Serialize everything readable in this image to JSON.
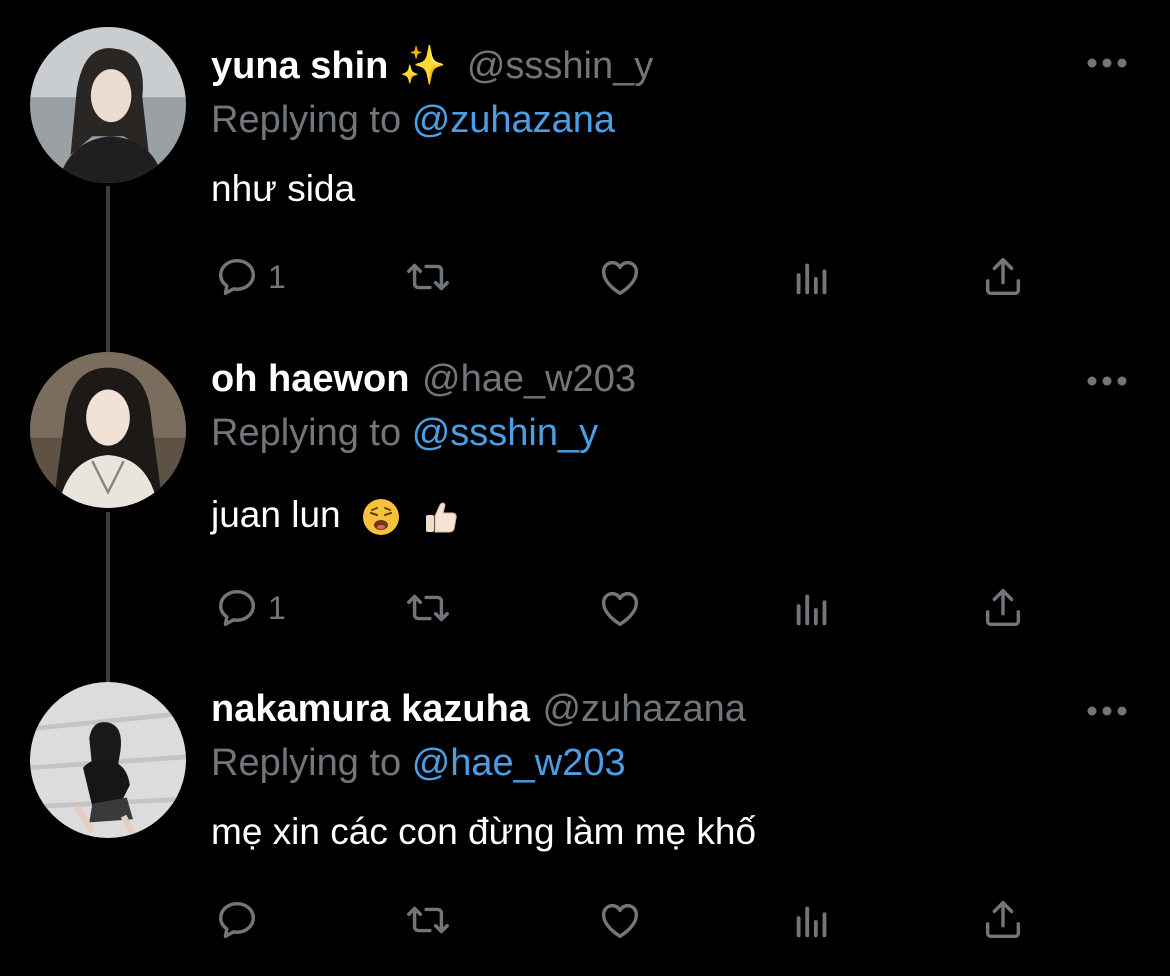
{
  "tweets": [
    {
      "name": "yuna shin",
      "name_suffix": "✨",
      "handle": "@ssshin_y",
      "replying_prefix": "Replying to",
      "replying_to": "@zuhazana",
      "text": "như sida",
      "reply_count": "1",
      "avatar_bg": "#8a8f92"
    },
    {
      "name": "oh haewon",
      "name_suffix": "",
      "handle": "@hae_w203",
      "replying_prefix": "Replying to",
      "replying_to": "@ssshin_y",
      "text": "juan lun",
      "emojis": [
        "weary-face",
        "thumbs-up-light"
      ],
      "reply_count": "1",
      "avatar_bg": "#6b5b4a"
    },
    {
      "name": "nakamura kazuha",
      "name_suffix": "",
      "handle": "@zuhazana",
      "replying_prefix": "Replying to",
      "replying_to": "@hae_w203",
      "text": "mẹ xin các con đừng làm mẹ khố",
      "reply_count": "",
      "avatar_bg": "#d8d8d8"
    }
  ],
  "icons": [
    "reply-icon",
    "retweet-icon",
    "like-icon",
    "analytics-icon",
    "share-icon",
    "more-icon"
  ],
  "colors": {
    "background": "#000000",
    "mention": "#4a9ee6",
    "muted": "#71767b",
    "thread_line": "#3a3f44"
  }
}
